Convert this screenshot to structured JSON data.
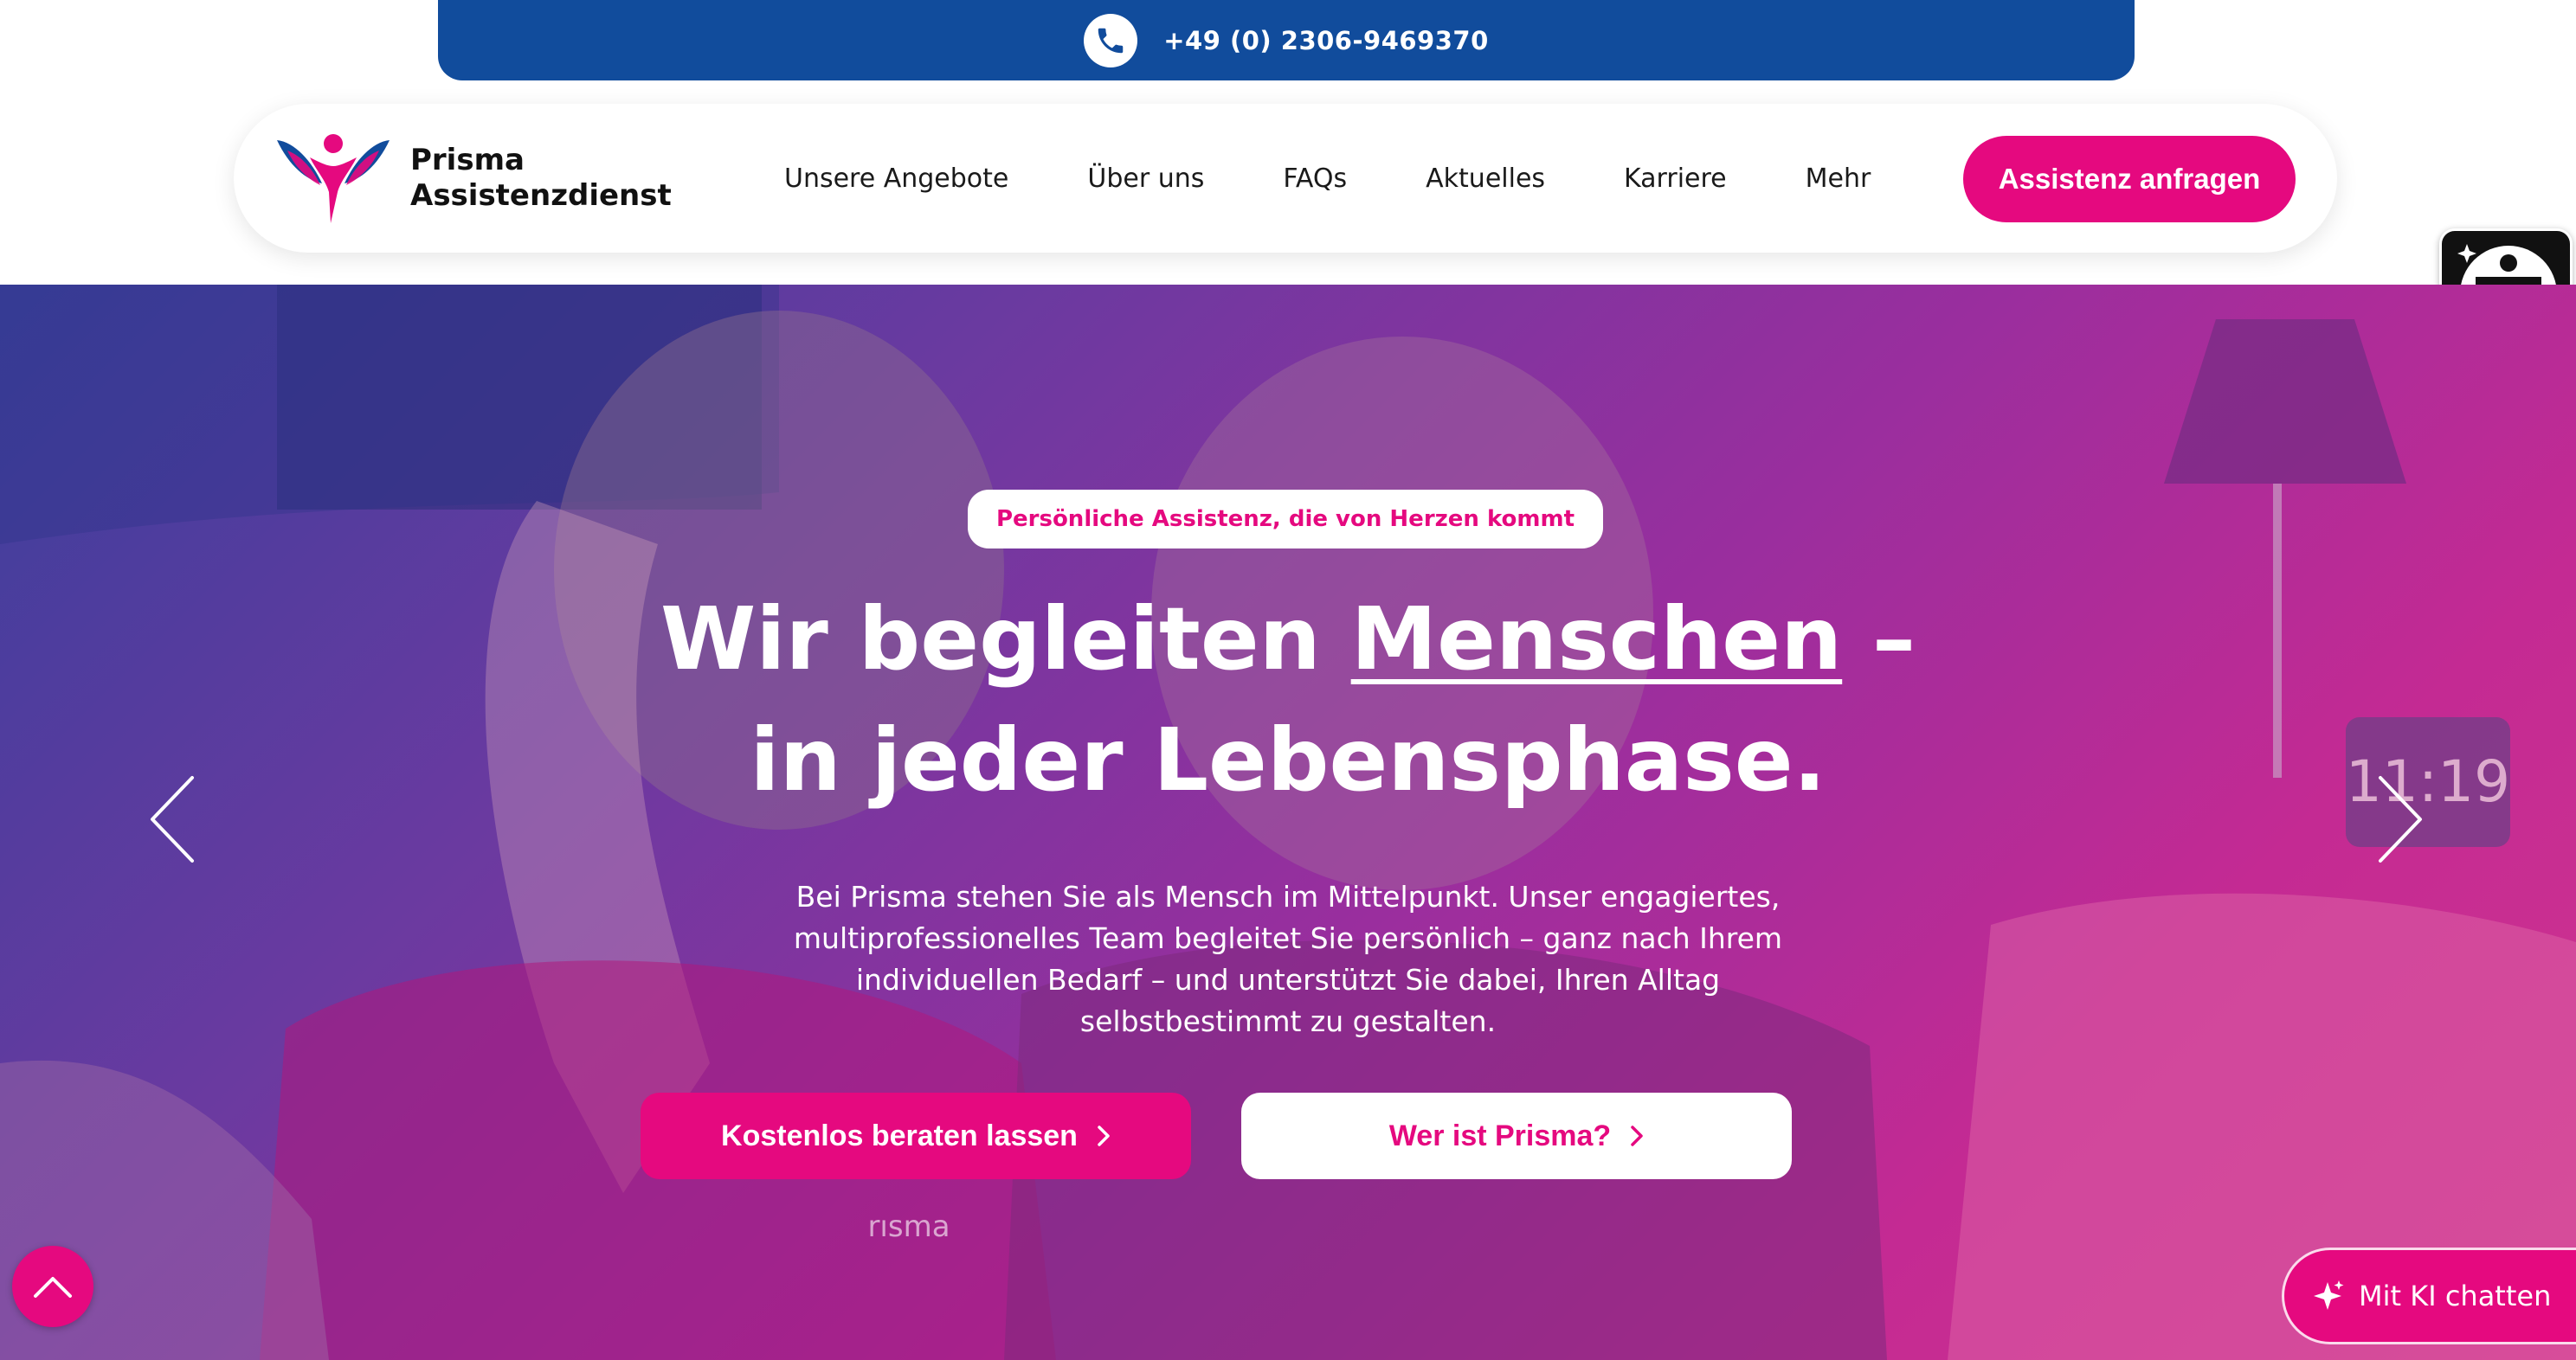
{
  "topbar": {
    "phone": "+49 (0) 2306-9469370",
    "icon": "phone-icon"
  },
  "header": {
    "brand_line1": "Prisma",
    "brand_line2": "Assistenzdienst",
    "nav": [
      {
        "label": "Unsere Angebote"
      },
      {
        "label": "Über uns"
      },
      {
        "label": "FAQs"
      },
      {
        "label": "Aktuelles"
      },
      {
        "label": "Karriere"
      },
      {
        "label": "Mehr"
      }
    ],
    "cta_label": "Assistenz anfragen"
  },
  "hero": {
    "tagline": "Persönliche Assistenz, die von Herzen kommt",
    "headline_part1": "Wir begleiten ",
    "headline_accent": "Menschen",
    "headline_part2": " –",
    "headline_line2": "in jeder Lebensphase.",
    "lead": "Bei Prisma stehen Sie als Mensch im Mittelpunkt. Unser engagiertes, multiprofessionelles Team begleitet Sie persönlich – ganz nach Ihrem individuellen Bedarf – und unterstützt Sie dabei, Ihren Alltag selbstbestimmt zu gestalten.",
    "primary_button": "Kostenlos beraten lassen",
    "secondary_button": "Wer ist Prisma?",
    "photo_clock": "11:19",
    "photo_shirt_text": "rısma"
  },
  "widgets": {
    "chat_label": "Mit KI chatten",
    "scroll_top_icon": "chevron-up-icon",
    "accessibility_icon": "accessibility-icon"
  },
  "colors": {
    "brand_blue": "#114c9c",
    "brand_pink": "#e5097f",
    "hero_gradient_start": "#3b3f9c",
    "hero_gradient_end": "#d0358e"
  }
}
